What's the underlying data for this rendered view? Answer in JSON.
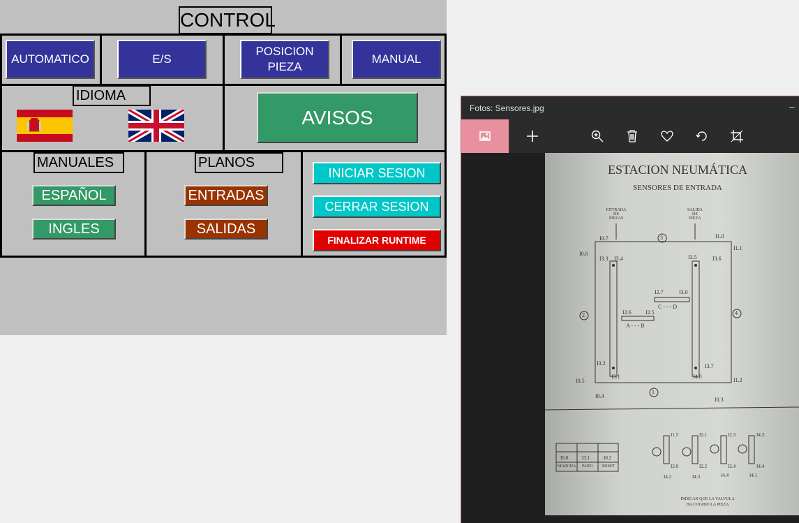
{
  "hmi": {
    "title": "CONTROL",
    "nav": [
      "AUTOMATICO",
      "E/S",
      "POSICION\nPIEZA",
      "MANUAL"
    ],
    "idioma_label": "IDIOMA",
    "avisos_label": "AVISOS",
    "manuales_label": "MANUALES",
    "manuales_buttons": [
      "ESPAÑOL",
      "INGLES"
    ],
    "planos_label": "PLANOS",
    "planos_buttons": [
      "ENTRADAS",
      "SALIDAS"
    ],
    "session_buttons": [
      "INICIAR SESION",
      "CERRAR SESION"
    ],
    "finalize_label": "FINALIZAR RUNTIME",
    "colors": {
      "nav": "#33339a",
      "green": "#339966",
      "brown": "#993300",
      "cyan": "#00c8c8",
      "red": "#e00000",
      "panel": "#c0c0c0"
    }
  },
  "viewer": {
    "title": "Fotos: Sensores.jpg",
    "toolbar_icons": [
      "image-icon",
      "add-icon",
      "zoom-in-icon",
      "delete-icon",
      "favorite-icon",
      "rotate-icon",
      "crop-icon"
    ],
    "photo": {
      "heading": "ESTACION NEUMÁTICA",
      "subheading": "SENSORES DE ENTRADA",
      "entrada": "ENTRADA\nDE\nPIEZAS",
      "salida": "SALIDA\nDE\nPIEZA",
      "sensor_labels": [
        "I0.7",
        "I1.0",
        "I1.1",
        "I0.6",
        "I3.3",
        "I3.4",
        "I3.5",
        "I3.6",
        "I2.7",
        "I3.0",
        "I2.6",
        "I2.5",
        "I3.2",
        "I3.1",
        "I4.0",
        "I3.7",
        "I0.5",
        "I1.2",
        "I0.4",
        "I0.3"
      ],
      "circled": [
        "3",
        "2",
        "4",
        "1"
      ],
      "cyl_ab": "A - - - B",
      "cyl_cd": "C - - - D",
      "table_values": [
        "I0.0",
        "I3.1",
        "I0.2"
      ],
      "table_labels": [
        "MARCHA",
        "PARO",
        "RESET"
      ],
      "bottom_labels": [
        "I1.5",
        "I2.1",
        "I2.3",
        "I4.3",
        "I2.0",
        "I2.2",
        "I2.4",
        "I4.4",
        "I4.2",
        "I4.3",
        "I4.4",
        "I4.1"
      ],
      "note": "INDICAN QUE LA VALVULA\nHA COGIDO LA PIEZA"
    }
  }
}
